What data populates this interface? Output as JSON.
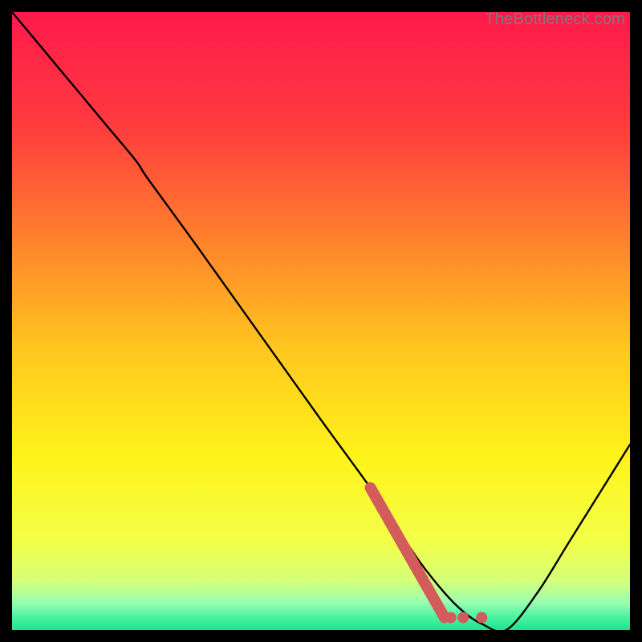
{
  "watermark": "TheBottleneck.com",
  "colors": {
    "frame": "#000000",
    "curve": "#000000",
    "highlight": "#d35b5b",
    "gradient_stops": [
      {
        "offset": 0.0,
        "color": "#ff1a4b"
      },
      {
        "offset": 0.18,
        "color": "#ff3a3f"
      },
      {
        "offset": 0.35,
        "color": "#ff7a2e"
      },
      {
        "offset": 0.55,
        "color": "#ffc81e"
      },
      {
        "offset": 0.72,
        "color": "#fff31a"
      },
      {
        "offset": 0.86,
        "color": "#f2ff4a"
      },
      {
        "offset": 0.92,
        "color": "#d5ff78"
      },
      {
        "offset": 0.955,
        "color": "#9bffb0"
      },
      {
        "offset": 0.975,
        "color": "#55f5a4"
      },
      {
        "offset": 1.0,
        "color": "#1fe38f"
      }
    ]
  },
  "chart_data": {
    "type": "line",
    "title": "",
    "xlabel": "",
    "ylabel": "",
    "x": [
      0,
      5,
      10,
      15,
      20,
      22,
      30,
      40,
      50,
      58,
      62,
      66,
      70,
      73,
      76,
      80,
      85,
      90,
      95,
      100
    ],
    "y": [
      100,
      94,
      88,
      82,
      76,
      73,
      62,
      48,
      34,
      23,
      17,
      11,
      6,
      3,
      1,
      0,
      6,
      14,
      22,
      30
    ],
    "xlim": [
      0,
      100
    ],
    "ylim": [
      0,
      100
    ],
    "highlight_segment": {
      "x0": 58,
      "y0": 23,
      "x1": 70,
      "y1": 2
    },
    "highlight_dots": [
      {
        "x": 71,
        "y": 2
      },
      {
        "x": 73,
        "y": 2
      },
      {
        "x": 76,
        "y": 2
      }
    ]
  }
}
